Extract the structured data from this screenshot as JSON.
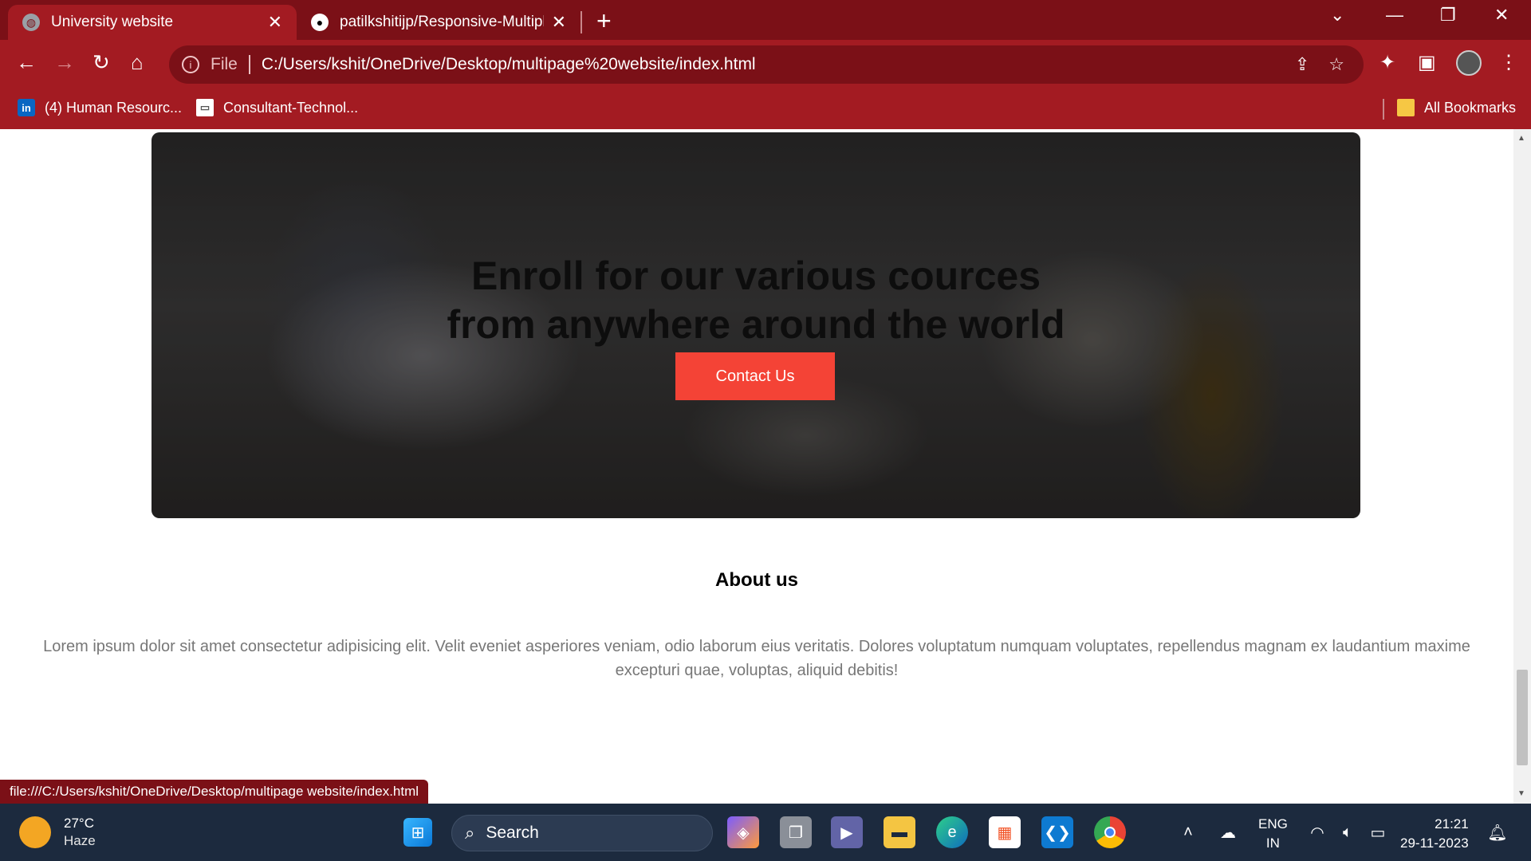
{
  "browser": {
    "tabs": [
      {
        "title": "University website",
        "active": true
      },
      {
        "title": "patilkshitijp/Responsive-Multiple",
        "active": false
      }
    ],
    "address": {
      "scheme_label": "File",
      "url": "C:/Users/kshit/OneDrive/Desktop/multipage%20website/index.html"
    },
    "bookmarks": [
      {
        "label": "(4) Human Resourc...",
        "icon": "linkedin-icon"
      },
      {
        "label": "Consultant-Technol...",
        "icon": "site-icon"
      }
    ],
    "all_bookmarks_label": "All Bookmarks",
    "status_url": "file:///C:/Users/kshit/OneDrive/Desktop/multipage website/index.html"
  },
  "page": {
    "hero": {
      "heading_line1": "Enroll for our various cources",
      "heading_line2": "from anywhere around the world",
      "button_label": "Contact Us"
    },
    "about": {
      "title": "About us",
      "text": "Lorem ipsum dolor sit amet consectetur adipisicing elit. Velit eveniet asperiores veniam, odio laborum eius veritatis. Dolores voluptatum numquam voluptates, repellendus magnam ex laudantium maxime excepturi quae, voluptas, aliquid debitis!"
    }
  },
  "taskbar": {
    "weather": {
      "temp": "27°C",
      "condition": "Haze"
    },
    "search_placeholder": "Search",
    "language": {
      "line1": "ENG",
      "line2": "IN"
    },
    "time": "21:21",
    "date": "29-11-2023"
  },
  "colors": {
    "browser_frame": "#7b1017",
    "browser_toolbar": "#a31b22",
    "contact_button": "#f44336",
    "taskbar": "#1c2a3e"
  }
}
